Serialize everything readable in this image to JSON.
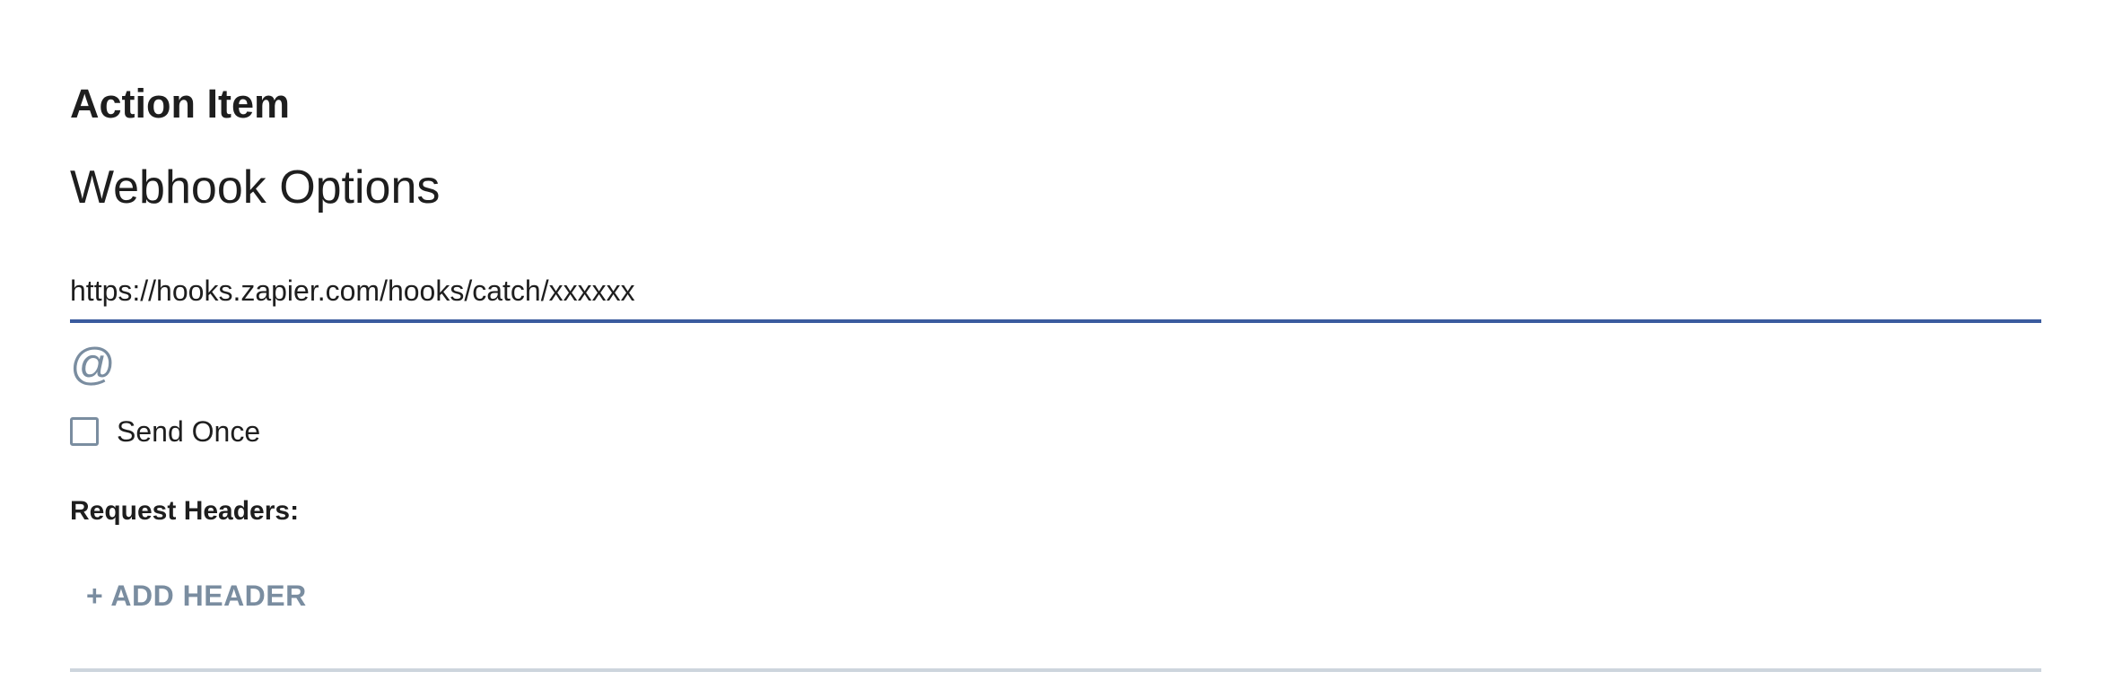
{
  "section": {
    "title": "Action Item"
  },
  "webhook": {
    "title": "Webhook Options",
    "url_value": "https://hooks.zapier.com/hooks/catch/xxxxxx",
    "insert_symbol": "@",
    "send_once": {
      "label": "Send Once",
      "checked": false
    },
    "request_headers_label": "Request Headers:",
    "add_header_label": "+ ADD HEADER"
  },
  "colors": {
    "accent_underline": "#3a5b9e",
    "muted": "#7a8da0",
    "divider": "#cdd5dd",
    "text": "#1e1e1e"
  },
  "icons": {
    "insert_variable": "at-icon"
  }
}
